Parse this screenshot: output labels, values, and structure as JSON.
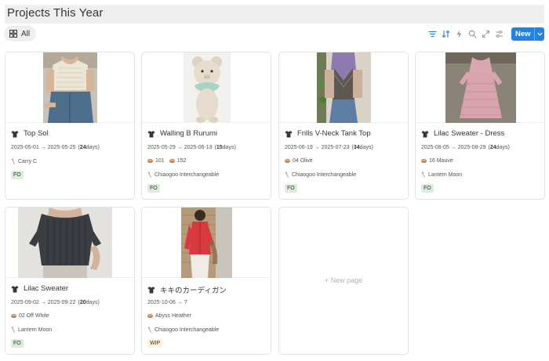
{
  "page": {
    "title": "Projects This Year"
  },
  "view": {
    "tab_label": "All",
    "tab_icon": "gallery-grid-icon"
  },
  "toolbar": {
    "tools": [
      "filter-icon",
      "sort-icon",
      "lightning-icon",
      "search-icon",
      "expand-icon",
      "settings-sliders-icon"
    ],
    "new_label": "New",
    "accent": "#2383e2"
  },
  "cards": [
    {
      "title": "Top Sol",
      "dates": "2025-05-01 → 2025-05-25",
      "duration": "24",
      "yarns": [],
      "needles": "Carry C",
      "status": "FO"
    },
    {
      "title": "Walling B Rurumi",
      "dates": "2025-05-29 → 2025-06-13",
      "duration": "15",
      "yarns": [
        "101",
        "152"
      ],
      "needles": "Chiaogoo Interchangeable",
      "status": "FO"
    },
    {
      "title": "Frills V-Neck Tank Top",
      "dates": "2025-06-19 → 2025-07-23",
      "duration": "34",
      "yarns": [
        "04 Olive"
      ],
      "needles": "Chiaogoo Interchangeable",
      "status": "FO"
    },
    {
      "title": "Lilac Sweater - Dress",
      "dates": "2025-08-05 → 2025-08-29",
      "duration": "24",
      "yarns": [
        "16 Mauve"
      ],
      "needles": "Lantern Moon",
      "status": "FO"
    },
    {
      "title": "Lilac Sweater",
      "dates": "2025-09-02 → 2025-09-22",
      "duration": "20",
      "yarns": [
        "02 Off White"
      ],
      "needles": "Lantern Moon",
      "status": "FO"
    },
    {
      "title": "キキのカーディガン",
      "dates": "2025-10-06 → ?",
      "duration": "",
      "yarns": [
        "Abyss Heather"
      ],
      "needles": "Chiaogoo Interchangeable",
      "status": "WIP"
    }
  ],
  "new_page_label": "+ New page",
  "labels": {
    "days_open": "(",
    "days_unit": " days)"
  },
  "status_colors": {
    "FO": "#dbeddb",
    "WIP": "#fbf3db"
  }
}
